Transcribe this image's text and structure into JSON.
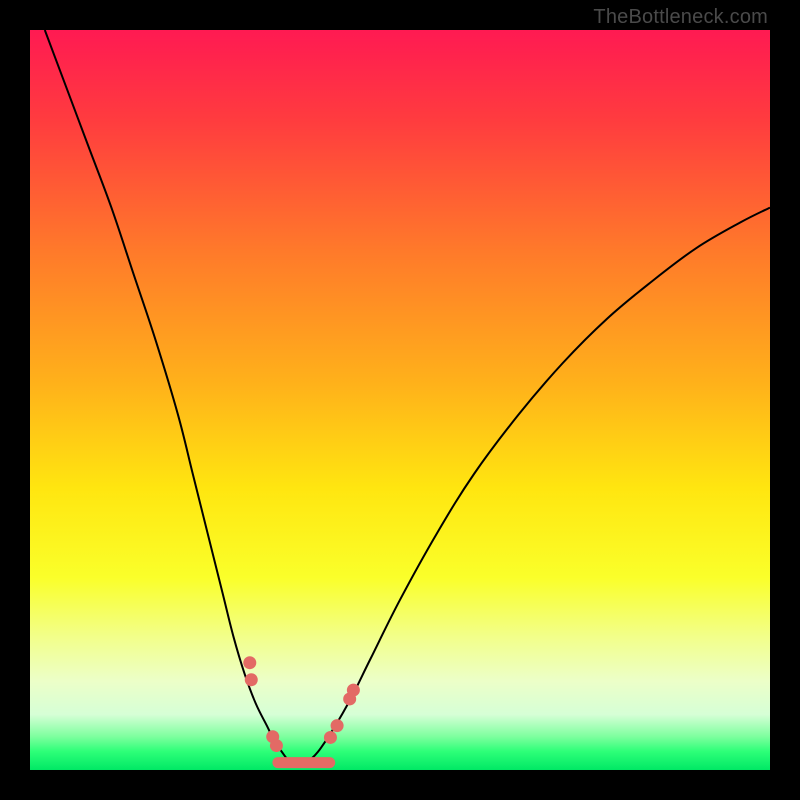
{
  "watermark": "TheBottleneck.com",
  "colors": {
    "frame_bg": "#000000",
    "marker": "#e36a65",
    "curve": "#000000"
  },
  "chart_data": {
    "type": "line",
    "title": "",
    "xlabel": "",
    "ylabel": "",
    "xlim": [
      0,
      100
    ],
    "ylim": [
      0,
      100
    ],
    "gradient_stops": [
      {
        "pos": 0.0,
        "color": "#ff1a52"
      },
      {
        "pos": 0.12,
        "color": "#ff3b3f"
      },
      {
        "pos": 0.3,
        "color": "#ff7a2a"
      },
      {
        "pos": 0.48,
        "color": "#ffb21a"
      },
      {
        "pos": 0.62,
        "color": "#ffe610"
      },
      {
        "pos": 0.74,
        "color": "#faff2a"
      },
      {
        "pos": 0.82,
        "color": "#f2ff8a"
      },
      {
        "pos": 0.88,
        "color": "#ecffc8"
      },
      {
        "pos": 0.925,
        "color": "#d6ffd6"
      },
      {
        "pos": 0.955,
        "color": "#7dff9e"
      },
      {
        "pos": 0.975,
        "color": "#2dff78"
      },
      {
        "pos": 1.0,
        "color": "#00e865"
      }
    ],
    "series": [
      {
        "name": "left_branch",
        "x": [
          2,
          5,
          8,
          11,
          14,
          17,
          20,
          22,
          24,
          26,
          27.5,
          29,
          30.5,
          32,
          33,
          34,
          35,
          36
        ],
        "y": [
          100,
          92,
          84,
          76,
          67,
          58,
          48,
          40,
          32,
          24,
          18,
          13,
          9,
          6,
          4,
          2.5,
          1.2,
          0.5
        ]
      },
      {
        "name": "right_branch",
        "x": [
          36,
          38,
          40,
          43,
          46,
          50,
          55,
          60,
          66,
          72,
          78,
          84,
          90,
          96,
          100
        ],
        "y": [
          0.5,
          1.5,
          4,
          9,
          15,
          23,
          32,
          40,
          48,
          55,
          61,
          66,
          70.5,
          74,
          76
        ]
      }
    ],
    "markers": {
      "left_dots": [
        {
          "x": 29.7,
          "y": 14.5
        },
        {
          "x": 29.9,
          "y": 12.2
        },
        {
          "x": 32.8,
          "y": 4.5
        },
        {
          "x": 33.3,
          "y": 3.3
        }
      ],
      "right_dots": [
        {
          "x": 40.6,
          "y": 4.4
        },
        {
          "x": 41.5,
          "y": 6.0
        },
        {
          "x": 43.2,
          "y": 9.6
        },
        {
          "x": 43.7,
          "y": 10.8
        }
      ],
      "bottom_line": {
        "x0": 33.5,
        "y0": 1.0,
        "x1": 40.5,
        "y1": 1.0
      }
    }
  }
}
